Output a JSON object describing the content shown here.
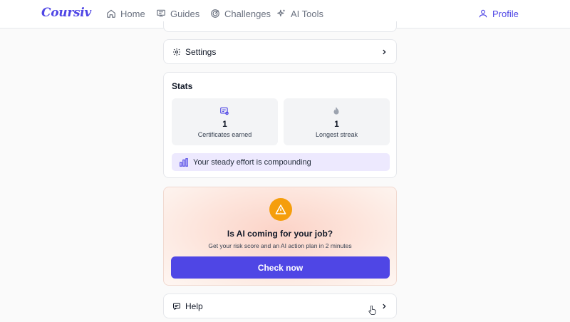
{
  "brand": {
    "logo_text": "Coursiv",
    "accent": "#4f46e5"
  },
  "nav": {
    "items": [
      {
        "label": "Home",
        "icon": "home-icon"
      },
      {
        "label": "Guides",
        "icon": "guides-icon"
      },
      {
        "label": "Challenges",
        "icon": "target-icon"
      },
      {
        "label": "AI Tools",
        "icon": "sparkles-icon"
      }
    ],
    "profile_label": "Profile"
  },
  "settings": {
    "label": "Settings",
    "icon": "gear-icon"
  },
  "stats": {
    "title": "Stats",
    "boxes": [
      {
        "value": "1",
        "label": "Certificates earned",
        "icon": "certificate-icon"
      },
      {
        "value": "1",
        "label": "Longest streak",
        "icon": "flame-icon"
      }
    ],
    "banner_text": "Your steady effort is compounding"
  },
  "ai_promo": {
    "title": "Is AI coming for your job?",
    "subtitle": "Get your risk score and an AI action plan in 2 minutes",
    "button_label": "Check now",
    "warning_color": "#f59e0b"
  },
  "help": {
    "label": "Help",
    "icon": "message-icon"
  }
}
